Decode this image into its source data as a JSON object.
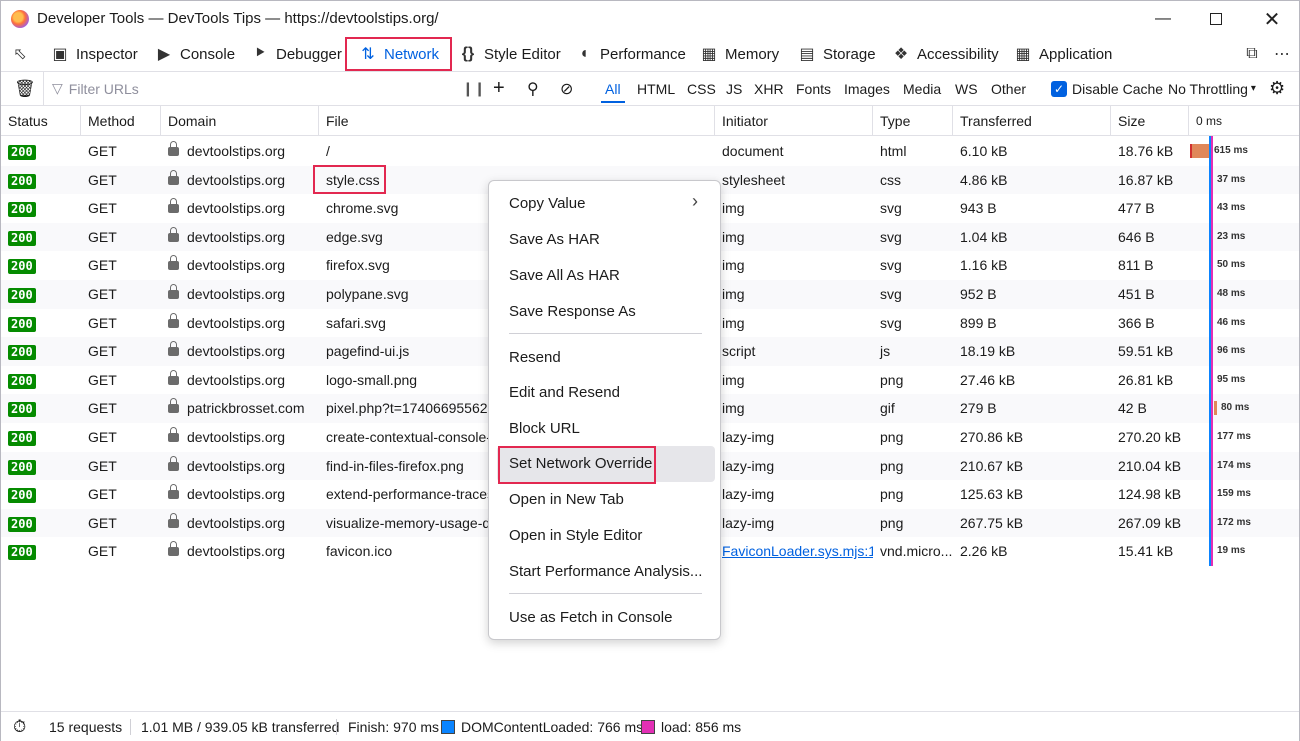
{
  "window": {
    "title": "Developer Tools — DevTools Tips — https://devtoolstips.org/"
  },
  "tabs": [
    {
      "label": "Inspector",
      "icon": "inspector-icon"
    },
    {
      "label": "Console",
      "icon": "console-icon"
    },
    {
      "label": "Debugger",
      "icon": "debugger-icon"
    },
    {
      "label": "Network",
      "icon": "network-icon",
      "active": true
    },
    {
      "label": "Style Editor",
      "icon": "style-editor-icon"
    },
    {
      "label": "Performance",
      "icon": "performance-icon"
    },
    {
      "label": "Memory",
      "icon": "memory-icon"
    },
    {
      "label": "Storage",
      "icon": "storage-icon"
    },
    {
      "label": "Accessibility",
      "icon": "accessibility-icon"
    },
    {
      "label": "Application",
      "icon": "application-icon"
    }
  ],
  "filter": {
    "placeholder": "Filter URLs",
    "types": [
      "All",
      "HTML",
      "CSS",
      "JS",
      "XHR",
      "Fonts",
      "Images",
      "Media",
      "WS",
      "Other"
    ],
    "active_type": "All",
    "disable_cache_label": "Disable Cache",
    "disable_cache_checked": true,
    "throttling": "No Throttling"
  },
  "columns": {
    "status": "Status",
    "method": "Method",
    "domain": "Domain",
    "file": "File",
    "initiator": "Initiator",
    "type": "Type",
    "transferred": "Transferred",
    "size": "Size",
    "waterfall": "0 ms"
  },
  "rows": [
    {
      "status": "200",
      "method": "GET",
      "domain": "devtoolstips.org",
      "file": "/",
      "initiator": "document",
      "type": "html",
      "transferred": "6.10 kB",
      "size": "18.76 kB",
      "time": "615 ms",
      "time_ms": 615
    },
    {
      "status": "200",
      "method": "GET",
      "domain": "devtoolstips.org",
      "file": "style.css",
      "initiator": "stylesheet",
      "type": "css",
      "transferred": "4.86 kB",
      "size": "16.87 kB",
      "time": "37 ms",
      "time_ms": 37
    },
    {
      "status": "200",
      "method": "GET",
      "domain": "devtoolstips.org",
      "file": "chrome.svg",
      "initiator": "img",
      "type": "svg",
      "transferred": "943 B",
      "size": "477 B",
      "time": "43 ms",
      "time_ms": 43
    },
    {
      "status": "200",
      "method": "GET",
      "domain": "devtoolstips.org",
      "file": "edge.svg",
      "initiator": "img",
      "type": "svg",
      "transferred": "1.04 kB",
      "size": "646 B",
      "time": "23 ms",
      "time_ms": 23
    },
    {
      "status": "200",
      "method": "GET",
      "domain": "devtoolstips.org",
      "file": "firefox.svg",
      "initiator": "img",
      "type": "svg",
      "transferred": "1.16 kB",
      "size": "811 B",
      "time": "50 ms",
      "time_ms": 50
    },
    {
      "status": "200",
      "method": "GET",
      "domain": "devtoolstips.org",
      "file": "polypane.svg",
      "initiator": "img",
      "type": "svg",
      "transferred": "952 B",
      "size": "451 B",
      "time": "48 ms",
      "time_ms": 48
    },
    {
      "status": "200",
      "method": "GET",
      "domain": "devtoolstips.org",
      "file": "safari.svg",
      "initiator": "img",
      "type": "svg",
      "transferred": "899 B",
      "size": "366 B",
      "time": "46 ms",
      "time_ms": 46
    },
    {
      "status": "200",
      "method": "GET",
      "domain": "devtoolstips.org",
      "file": "pagefind-ui.js",
      "initiator": "script",
      "type": "js",
      "transferred": "18.19 kB",
      "size": "59.51 kB",
      "time": "96 ms",
      "time_ms": 96
    },
    {
      "status": "200",
      "method": "GET",
      "domain": "devtoolstips.org",
      "file": "logo-small.png",
      "initiator": "img",
      "type": "png",
      "transferred": "27.46 kB",
      "size": "26.81 kB",
      "time": "95 ms",
      "time_ms": 95
    },
    {
      "status": "200",
      "method": "GET",
      "domain": "patrickbrosset.com",
      "file": "pixel.php?t=1740669556207",
      "initiator": "img",
      "type": "gif",
      "transferred": "279 B",
      "size": "42 B",
      "time": "80 ms",
      "time_ms": 80
    },
    {
      "status": "200",
      "method": "GET",
      "domain": "devtoolstips.org",
      "file": "create-contextual-console-logs.png",
      "initiator": "lazy-img",
      "type": "png",
      "transferred": "270.86 kB",
      "size": "270.20 kB",
      "time": "177 ms",
      "time_ms": 177
    },
    {
      "status": "200",
      "method": "GET",
      "domain": "devtoolstips.org",
      "file": "find-in-files-firefox.png",
      "initiator": "lazy-img",
      "type": "png",
      "transferred": "210.67 kB",
      "size": "210.04 kB",
      "time": "174 ms",
      "time_ms": 174
    },
    {
      "status": "200",
      "method": "GET",
      "domain": "devtoolstips.org",
      "file": "extend-performance-traces.png",
      "initiator": "lazy-img",
      "type": "png",
      "transferred": "125.63 kB",
      "size": "124.98 kB",
      "time": "159 ms",
      "time_ms": 159
    },
    {
      "status": "200",
      "method": "GET",
      "domain": "devtoolstips.org",
      "file": "visualize-memory-usage-during.png",
      "initiator": "lazy-img",
      "type": "png",
      "transferred": "267.75 kB",
      "size": "267.09 kB",
      "time": "172 ms",
      "time_ms": 172
    },
    {
      "status": "200",
      "method": "GET",
      "domain": "devtoolstips.org",
      "file": "favicon.ico",
      "initiator": "FaviconLoader.sys.mjs:1...",
      "type": "vnd.micro...",
      "transferred": "2.26 kB",
      "size": "15.41 kB",
      "time": "19 ms",
      "time_ms": 19
    }
  ],
  "context_menu": {
    "items": [
      {
        "label": "Copy Value",
        "submenu": true
      },
      {
        "label": "Save As HAR"
      },
      {
        "label": "Save All As HAR"
      },
      {
        "label": "Save Response As"
      },
      {
        "label": "Resend"
      },
      {
        "label": "Edit and Resend"
      },
      {
        "label": "Block URL"
      },
      {
        "label": "Set Network Override",
        "highlighted": true
      },
      {
        "label": "Open in New Tab"
      },
      {
        "label": "Open in Style Editor"
      },
      {
        "label": "Start Performance Analysis..."
      },
      {
        "label": "Use as Fetch in Console"
      }
    ]
  },
  "footer": {
    "requests": "15 requests",
    "transferred": "1.01 MB / 939.05 kB transferred",
    "finish": "Finish: 970 ms",
    "dom_content_loaded": "DOMContentLoaded: 766 ms",
    "load": "load: 856 ms"
  },
  "colors": {
    "accent": "#0061e0",
    "highlight_box": "#e22850",
    "status_ok": "#058b00",
    "dcl": "#0a84ff",
    "load": "#e22fb5"
  }
}
